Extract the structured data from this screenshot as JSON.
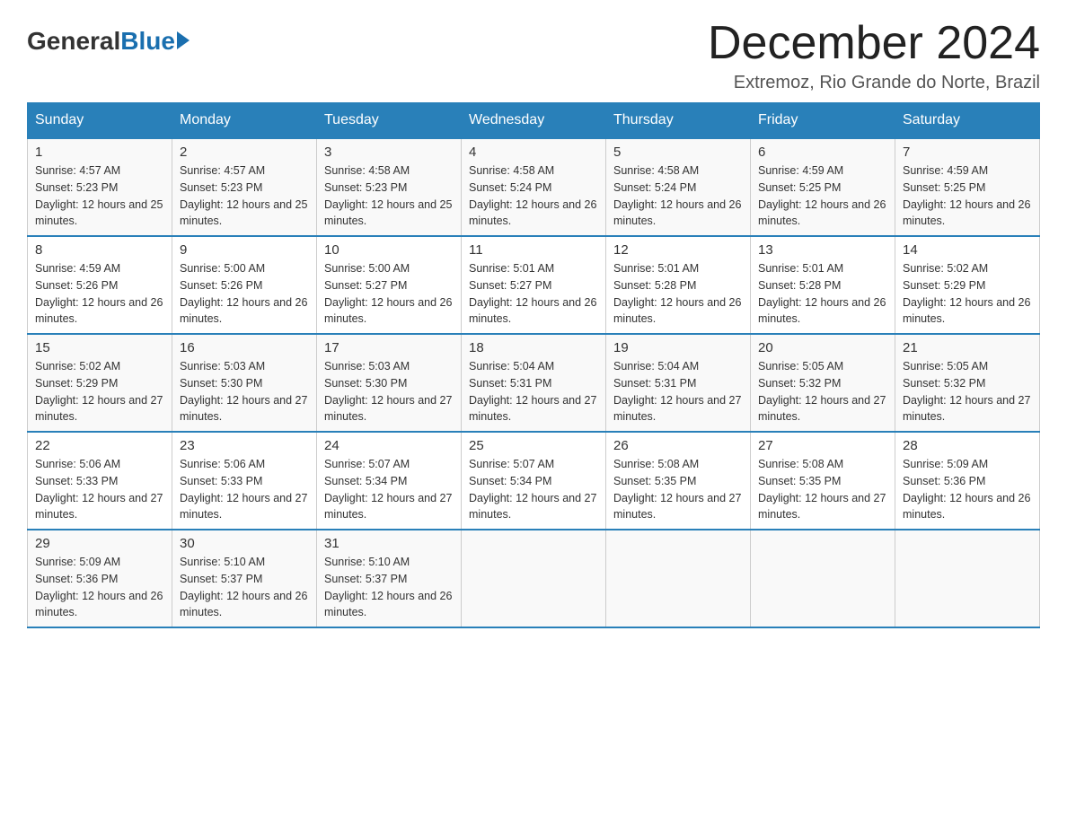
{
  "header": {
    "logo": {
      "general": "General",
      "blue": "Blue"
    },
    "title": "December 2024",
    "location": "Extremoz, Rio Grande do Norte, Brazil"
  },
  "weekdays": [
    "Sunday",
    "Monday",
    "Tuesday",
    "Wednesday",
    "Thursday",
    "Friday",
    "Saturday"
  ],
  "weeks": [
    [
      {
        "day": "1",
        "sunrise": "Sunrise: 4:57 AM",
        "sunset": "Sunset: 5:23 PM",
        "daylight": "Daylight: 12 hours and 25 minutes."
      },
      {
        "day": "2",
        "sunrise": "Sunrise: 4:57 AM",
        "sunset": "Sunset: 5:23 PM",
        "daylight": "Daylight: 12 hours and 25 minutes."
      },
      {
        "day": "3",
        "sunrise": "Sunrise: 4:58 AM",
        "sunset": "Sunset: 5:23 PM",
        "daylight": "Daylight: 12 hours and 25 minutes."
      },
      {
        "day": "4",
        "sunrise": "Sunrise: 4:58 AM",
        "sunset": "Sunset: 5:24 PM",
        "daylight": "Daylight: 12 hours and 26 minutes."
      },
      {
        "day": "5",
        "sunrise": "Sunrise: 4:58 AM",
        "sunset": "Sunset: 5:24 PM",
        "daylight": "Daylight: 12 hours and 26 minutes."
      },
      {
        "day": "6",
        "sunrise": "Sunrise: 4:59 AM",
        "sunset": "Sunset: 5:25 PM",
        "daylight": "Daylight: 12 hours and 26 minutes."
      },
      {
        "day": "7",
        "sunrise": "Sunrise: 4:59 AM",
        "sunset": "Sunset: 5:25 PM",
        "daylight": "Daylight: 12 hours and 26 minutes."
      }
    ],
    [
      {
        "day": "8",
        "sunrise": "Sunrise: 4:59 AM",
        "sunset": "Sunset: 5:26 PM",
        "daylight": "Daylight: 12 hours and 26 minutes."
      },
      {
        "day": "9",
        "sunrise": "Sunrise: 5:00 AM",
        "sunset": "Sunset: 5:26 PM",
        "daylight": "Daylight: 12 hours and 26 minutes."
      },
      {
        "day": "10",
        "sunrise": "Sunrise: 5:00 AM",
        "sunset": "Sunset: 5:27 PM",
        "daylight": "Daylight: 12 hours and 26 minutes."
      },
      {
        "day": "11",
        "sunrise": "Sunrise: 5:01 AM",
        "sunset": "Sunset: 5:27 PM",
        "daylight": "Daylight: 12 hours and 26 minutes."
      },
      {
        "day": "12",
        "sunrise": "Sunrise: 5:01 AM",
        "sunset": "Sunset: 5:28 PM",
        "daylight": "Daylight: 12 hours and 26 minutes."
      },
      {
        "day": "13",
        "sunrise": "Sunrise: 5:01 AM",
        "sunset": "Sunset: 5:28 PM",
        "daylight": "Daylight: 12 hours and 26 minutes."
      },
      {
        "day": "14",
        "sunrise": "Sunrise: 5:02 AM",
        "sunset": "Sunset: 5:29 PM",
        "daylight": "Daylight: 12 hours and 26 minutes."
      }
    ],
    [
      {
        "day": "15",
        "sunrise": "Sunrise: 5:02 AM",
        "sunset": "Sunset: 5:29 PM",
        "daylight": "Daylight: 12 hours and 27 minutes."
      },
      {
        "day": "16",
        "sunrise": "Sunrise: 5:03 AM",
        "sunset": "Sunset: 5:30 PM",
        "daylight": "Daylight: 12 hours and 27 minutes."
      },
      {
        "day": "17",
        "sunrise": "Sunrise: 5:03 AM",
        "sunset": "Sunset: 5:30 PM",
        "daylight": "Daylight: 12 hours and 27 minutes."
      },
      {
        "day": "18",
        "sunrise": "Sunrise: 5:04 AM",
        "sunset": "Sunset: 5:31 PM",
        "daylight": "Daylight: 12 hours and 27 minutes."
      },
      {
        "day": "19",
        "sunrise": "Sunrise: 5:04 AM",
        "sunset": "Sunset: 5:31 PM",
        "daylight": "Daylight: 12 hours and 27 minutes."
      },
      {
        "day": "20",
        "sunrise": "Sunrise: 5:05 AM",
        "sunset": "Sunset: 5:32 PM",
        "daylight": "Daylight: 12 hours and 27 minutes."
      },
      {
        "day": "21",
        "sunrise": "Sunrise: 5:05 AM",
        "sunset": "Sunset: 5:32 PM",
        "daylight": "Daylight: 12 hours and 27 minutes."
      }
    ],
    [
      {
        "day": "22",
        "sunrise": "Sunrise: 5:06 AM",
        "sunset": "Sunset: 5:33 PM",
        "daylight": "Daylight: 12 hours and 27 minutes."
      },
      {
        "day": "23",
        "sunrise": "Sunrise: 5:06 AM",
        "sunset": "Sunset: 5:33 PM",
        "daylight": "Daylight: 12 hours and 27 minutes."
      },
      {
        "day": "24",
        "sunrise": "Sunrise: 5:07 AM",
        "sunset": "Sunset: 5:34 PM",
        "daylight": "Daylight: 12 hours and 27 minutes."
      },
      {
        "day": "25",
        "sunrise": "Sunrise: 5:07 AM",
        "sunset": "Sunset: 5:34 PM",
        "daylight": "Daylight: 12 hours and 27 minutes."
      },
      {
        "day": "26",
        "sunrise": "Sunrise: 5:08 AM",
        "sunset": "Sunset: 5:35 PM",
        "daylight": "Daylight: 12 hours and 27 minutes."
      },
      {
        "day": "27",
        "sunrise": "Sunrise: 5:08 AM",
        "sunset": "Sunset: 5:35 PM",
        "daylight": "Daylight: 12 hours and 27 minutes."
      },
      {
        "day": "28",
        "sunrise": "Sunrise: 5:09 AM",
        "sunset": "Sunset: 5:36 PM",
        "daylight": "Daylight: 12 hours and 26 minutes."
      }
    ],
    [
      {
        "day": "29",
        "sunrise": "Sunrise: 5:09 AM",
        "sunset": "Sunset: 5:36 PM",
        "daylight": "Daylight: 12 hours and 26 minutes."
      },
      {
        "day": "30",
        "sunrise": "Sunrise: 5:10 AM",
        "sunset": "Sunset: 5:37 PM",
        "daylight": "Daylight: 12 hours and 26 minutes."
      },
      {
        "day": "31",
        "sunrise": "Sunrise: 5:10 AM",
        "sunset": "Sunset: 5:37 PM",
        "daylight": "Daylight: 12 hours and 26 minutes."
      },
      null,
      null,
      null,
      null
    ]
  ]
}
